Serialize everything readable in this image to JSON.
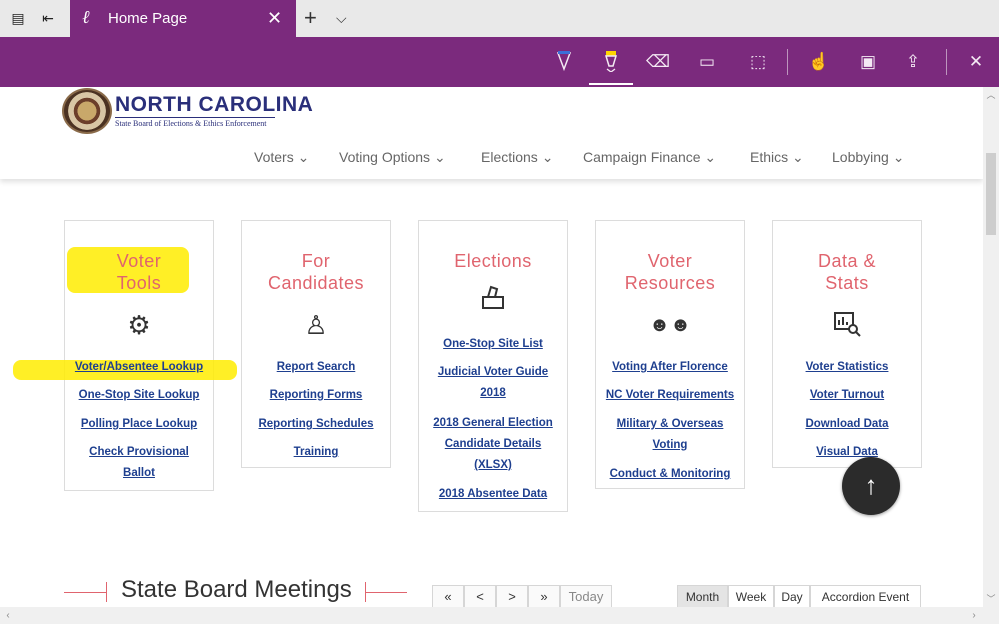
{
  "tabbar": {
    "tab_title": "Home Page",
    "close_glyph": "✕",
    "new_tab_glyph": "+",
    "tab_list_glyph": "⌵"
  },
  "ink_toolbar": {
    "tools": [
      "ballpoint-pen",
      "highlighter",
      "eraser",
      "add-note",
      "clip",
      "touch-writing",
      "save",
      "share",
      "exit"
    ],
    "active_tool": "highlighter"
  },
  "site": {
    "logo_title": "NORTH CAROLINA",
    "logo_subtitle": "State Board of Elections & Ethics Enforcement",
    "nav": [
      {
        "label": "Voters ⌄"
      },
      {
        "label": "Voting Options ⌄"
      },
      {
        "label": "Elections ⌄"
      },
      {
        "label": "Campaign Finance ⌄"
      },
      {
        "label": "Ethics ⌄"
      },
      {
        "label": "Lobbying ⌄"
      }
    ]
  },
  "cards": [
    {
      "title_lines": [
        "Voter",
        "Tools"
      ],
      "icon": "gears-icon",
      "links": [
        "Voter/Absentee Lookup",
        "One-Stop Site Lookup",
        "Polling Place Lookup",
        "Check Provisional",
        "Ballot"
      ]
    },
    {
      "title_lines": [
        "For",
        "Candidates"
      ],
      "icon": "candidate-podium-icon",
      "links": [
        "Report Search",
        "Reporting Forms",
        "Reporting Schedules",
        "Training"
      ]
    },
    {
      "title_lines": [
        "Elections"
      ],
      "icon": "ballot-box-icon",
      "links": [
        "One-Stop Site List",
        "Judicial Voter Guide",
        "2018",
        "2018 General Election",
        "Candidate Details",
        "(XLSX)",
        "2018 Absentee Data"
      ]
    },
    {
      "title_lines": [
        "Voter",
        "Resources"
      ],
      "icon": "people-icon",
      "links": [
        "Voting After Florence",
        "NC Voter Requirements",
        "Military & Overseas",
        "Voting",
        "Conduct & Monitoring"
      ]
    },
    {
      "title_lines": [
        "Data &",
        "Stats"
      ],
      "icon": "chart-search-icon",
      "links": [
        "Voter Statistics",
        "Voter Turnout",
        "Download Data",
        "Visual Data"
      ]
    }
  ],
  "meetings": {
    "title": "State Board Meetings"
  },
  "calendar": {
    "nav": [
      "«",
      "<",
      ">",
      "»"
    ],
    "today": "Today",
    "views": [
      "Month",
      "Week",
      "Day",
      "Accordion Event"
    ],
    "active_view": "Month"
  },
  "back_to_top_glyph": "↑",
  "colors": {
    "edge_purple": "#7b2a7d",
    "card_title": "#e0646e",
    "link": "#1e3f8f",
    "highlight": "#ffec00"
  }
}
